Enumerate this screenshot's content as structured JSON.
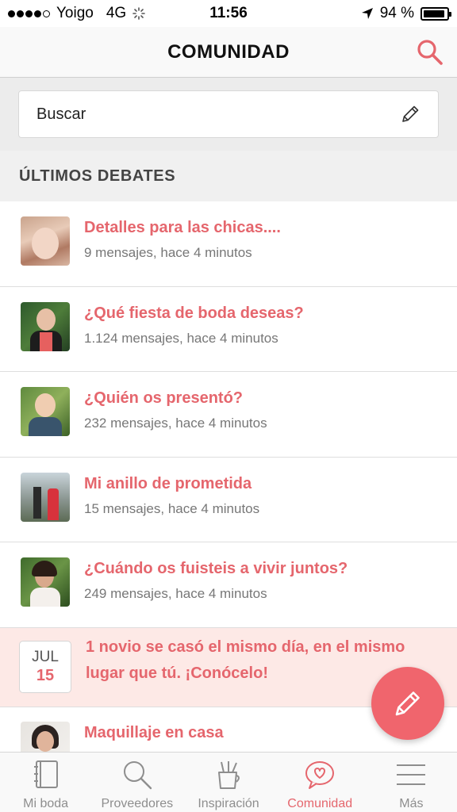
{
  "status": {
    "carrier": "Yoigo",
    "network": "4G",
    "time": "11:56",
    "battery_text": "94 %",
    "battery_level": 0.94
  },
  "header": {
    "title": "COMUNIDAD",
    "search_icon": "search-icon"
  },
  "search": {
    "placeholder": "Buscar",
    "icon": "pencil-icon"
  },
  "section": {
    "title": "ÚLTIMOS DEBATES"
  },
  "debates": [
    {
      "title": "Detalles para las chicas....",
      "meta": "9 mensajes, hace 4 minutos"
    },
    {
      "title": "¿Qué fiesta de boda deseas?",
      "meta": "1.124 mensajes, hace 4 minutos"
    },
    {
      "title": "¿Quién os presentó?",
      "meta": "232 mensajes, hace 4 minutos"
    },
    {
      "title": "Mi anillo de prometida",
      "meta": "15 mensajes, hace 4 minutos"
    },
    {
      "title": "¿Cuándo os fuisteis a vivir juntos?",
      "meta": "249 mensajes, hace 4 minutos"
    }
  ],
  "promo": {
    "month": "JUL",
    "day": "15",
    "text": "1 novio se casó el mismo día, en el mismo lugar que tú. ¡Conócelo!"
  },
  "last_debate": {
    "title": "Maquillaje en casa"
  },
  "tabs": [
    {
      "label": "Mi boda",
      "icon": "notebook-icon",
      "active": false
    },
    {
      "label": "Proveedores",
      "icon": "magnifier-icon",
      "active": false
    },
    {
      "label": "Inspiración",
      "icon": "brush-cup-icon",
      "active": false
    },
    {
      "label": "Comunidad",
      "icon": "heart-bubble-icon",
      "active": true
    },
    {
      "label": "Más",
      "icon": "menu-icon",
      "active": false
    }
  ],
  "colors": {
    "accent": "#e5666d",
    "fab": "#f0656d",
    "promo_bg": "#fde9e6"
  }
}
